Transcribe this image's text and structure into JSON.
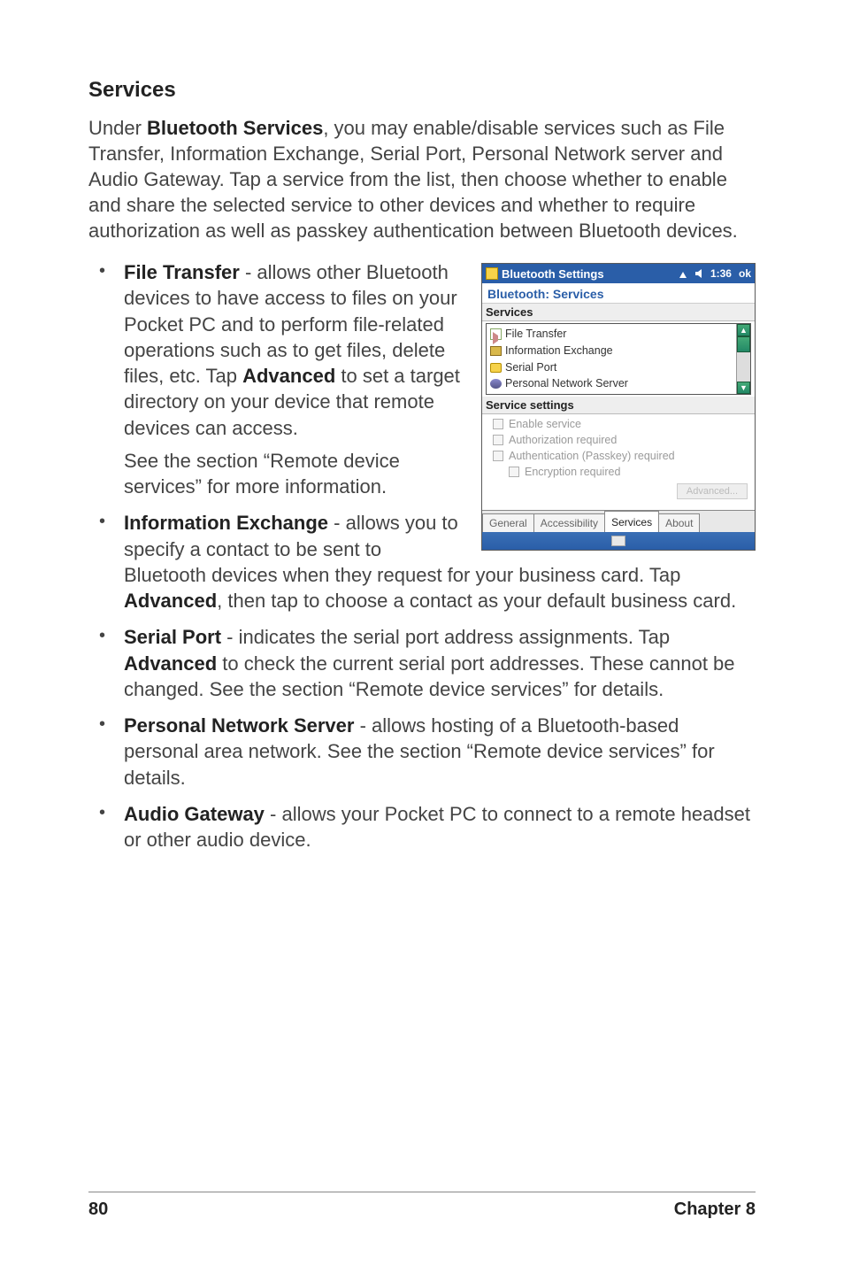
{
  "heading": "Services",
  "intro": {
    "prefix": "Under ",
    "bold": "Bluetooth Services",
    "rest": ", you may enable/disable services such as File Transfer, Information Exchange, Serial Port, Personal Network server and Audio Gateway. Tap a service from the list, then choose whether to enable and share the selected service to other devices and whether to require authorization as well as passkey authentication between Bluetooth devices."
  },
  "bullets_top": [
    {
      "title": "File Transfer",
      "body1": " - allows other Bluetooth devices to have access to files on your Pocket PC and to perform file-related operations such as to get files, delete files, etc. Tap ",
      "bold_inner": "Advanced",
      "body2": " to set a target directory on your device that remote devices can access.",
      "sub": "See the section “Remote device services” for more information."
    },
    {
      "title": "Information Exchange",
      "body1": " - allows you to specify a contact to be sent to Bluetooth devices when they request for your business card. Tap ",
      "bold_inner": "Advanced",
      "body2": ", then tap to choose a contact as your default business card.",
      "sub": ""
    }
  ],
  "bullets_bottom": [
    {
      "title": "Serial Port",
      "body1": " - indicates the serial port address assignments. Tap ",
      "bold_inner": "Advanced",
      "body2": " to check the current serial port addresses.  These cannot be changed.  See the section “Remote device services” for details."
    },
    {
      "title": "Personal Network Server",
      "body1": " - allows hosting of a Bluetooth-based personal area network. See the section “Remote device services” for details.",
      "bold_inner": "",
      "body2": ""
    },
    {
      "title": "Audio Gateway",
      "body1": " - allows your Pocket PC to connect to a remote headset or other audio device.",
      "bold_inner": "",
      "body2": ""
    }
  ],
  "screenshot": {
    "titlebar": {
      "app": "Bluetooth Settings",
      "time": "1:36",
      "ok": "ok"
    },
    "subtitle": "Bluetooth: Services",
    "services_label": "Services",
    "services_list": [
      "File Transfer",
      "Information Exchange",
      "Serial Port",
      "Personal Network Server"
    ],
    "settings_label": "Service settings",
    "checkboxes": [
      "Enable service",
      "Authorization required",
      "Authentication (Passkey) required",
      "Encryption required"
    ],
    "advanced_btn": "Advanced...",
    "tabs": [
      "General",
      "Accessibility",
      "Services",
      "About"
    ],
    "active_tab_index": 2
  },
  "footer": {
    "page": "80",
    "chapter": "Chapter 8"
  }
}
